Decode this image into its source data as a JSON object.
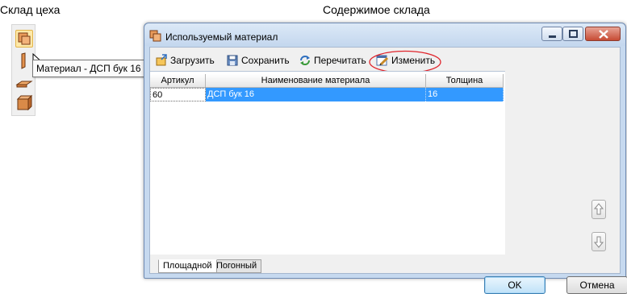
{
  "captions": {
    "workshop_store": "Склад цеха",
    "store_contents": "Содержимое склада"
  },
  "palette": {
    "icons": [
      "material-panel-icon",
      "edge-banding-icon",
      "strip-material-icon",
      "block-material-icon"
    ],
    "tooltip": "Материал - ДСП бук 16"
  },
  "window": {
    "title": "Используемый материал",
    "toolbar": {
      "load": "Загрузить",
      "save": "Сохранить",
      "reread": "Перечитать",
      "edit": "Изменить"
    },
    "grid": {
      "columns": [
        "Артикул",
        "Наименование материала",
        "Толщина"
      ],
      "rows": [
        {
          "article": "60",
          "name": "ДСП бук 16",
          "thickness": "16"
        }
      ]
    },
    "tabs": [
      "Площадной",
      "Погонный"
    ],
    "buttons": {
      "ok": "OK",
      "cancel": "Отмена"
    }
  },
  "colors": {
    "selection": "#3399ff",
    "highlight_ellipse": "#e0242b",
    "window_frame": "#c6d9ef"
  }
}
